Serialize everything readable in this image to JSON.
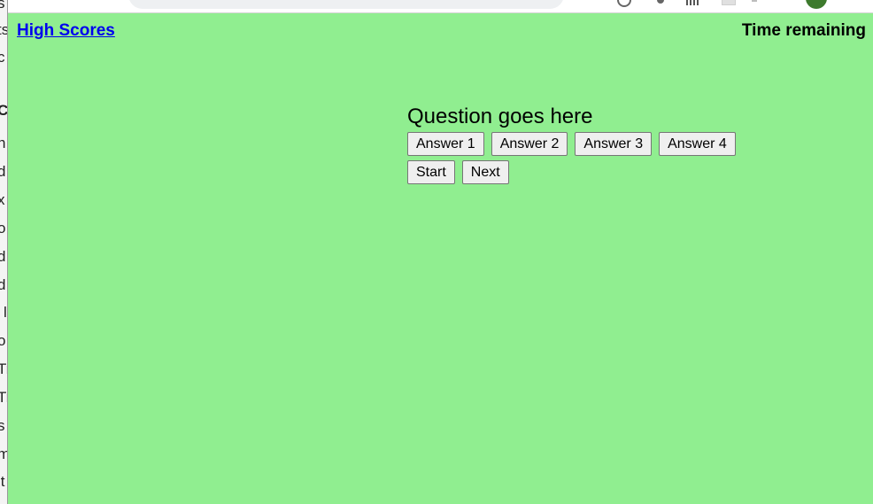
{
  "background_window": {
    "fragments": [
      "s",
      "ts",
      "c",
      "C",
      "n",
      "d",
      "x",
      "o",
      "d",
      "d",
      "l",
      "o",
      "Tr",
      "Tr",
      "s",
      "m",
      "lt"
    ]
  },
  "browser": {
    "toolbar_icons": [
      "history-icon",
      "key-icon",
      "reading-list-icon",
      "tab-icon",
      "extension-icon",
      "profile-avatar-icon"
    ]
  },
  "page": {
    "background_color": "#90ee90",
    "high_scores_link": "High Scores",
    "time_remaining": "Time remaining",
    "question": "Question goes here",
    "answers": [
      "Answer 1",
      "Answer 2",
      "Answer 3",
      "Answer 4"
    ],
    "start_label": "Start",
    "next_label": "Next"
  }
}
